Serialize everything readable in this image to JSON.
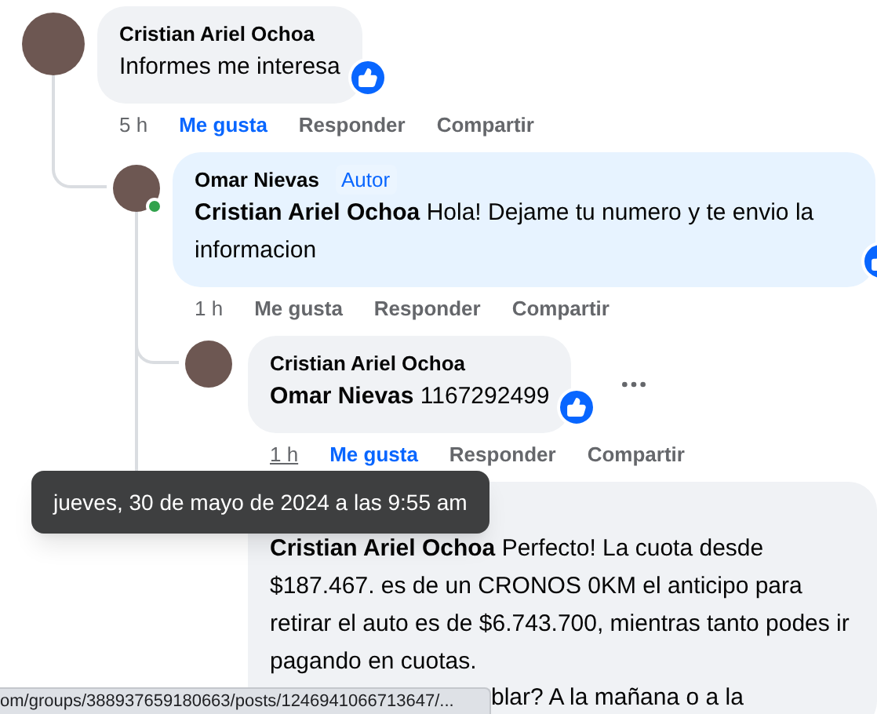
{
  "comments": [
    {
      "author": "Cristian Ariel Ochoa",
      "text": "Informes me interesa",
      "reaction": true,
      "time": "5 h",
      "liked": true,
      "hovered": false,
      "online": false,
      "actions": [
        "Me gusta",
        "Responder",
        "Compartir"
      ],
      "children": [
        {
          "author": "Omar Nievas",
          "author_badge": "Autor",
          "mention": "Cristian Ariel Ochoa",
          "text": "Hola! Dejame tu numero y te envio la informacion",
          "reaction": true,
          "time": "1 h",
          "liked": false,
          "hovered": false,
          "online": true,
          "actions": [
            "Me gusta",
            "Responder",
            "Compartir"
          ],
          "children": [
            {
              "author": "Cristian Ariel Ochoa",
              "mention": "Omar Nievas",
              "text": "1167292499",
              "reaction": true,
              "time": "1 h",
              "liked": true,
              "hovered": true,
              "online": false,
              "actions": [
                "Me gusta",
                "Responder",
                "Compartir"
              ]
            },
            {
              "mention": "Cristian Ariel Ochoa",
              "text": "Perfecto! La cuota desde $187.467. es de un CRONOS 0KM el anticipo para retirar el auto es de $6.743.700, mientras tanto podes ir pagando en cuotas.",
              "partial_line": "blar? A la mañana o a la"
            }
          ]
        }
      ]
    }
  ],
  "tooltip": "jueves, 30 de mayo de 2024 a las 9:55 am",
  "status_url": "om/groups/388937659180663/posts/1246941066713647/..."
}
